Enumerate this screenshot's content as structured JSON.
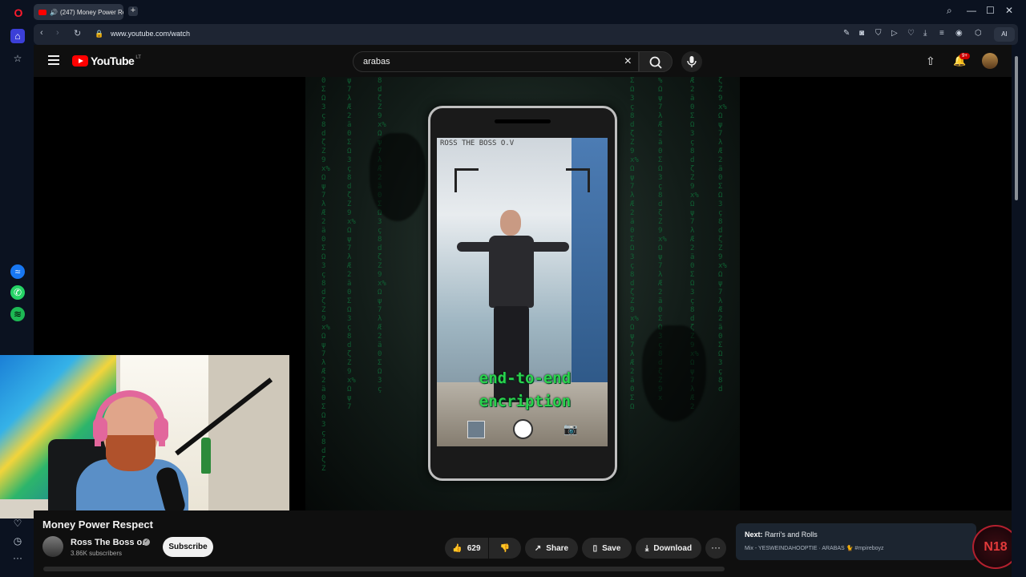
{
  "browser": {
    "tab_title": "(247) Money Power Re",
    "new_tab": "+",
    "url": "www.youtube.com/watch",
    "ai_label": "AI"
  },
  "youtube": {
    "logo_text": "YouTube",
    "country_code": "LT",
    "search_query": "arabas",
    "notification_badge": "9+"
  },
  "video_art": {
    "phone_watermark": "ROSS THE BOSS O.V",
    "caption_line1": "end-to-end",
    "caption_line2": "encription"
  },
  "video": {
    "title": "Money Power Respect",
    "channel_name": "Ross The Boss o.v",
    "subscribers": "3.86K subscribers",
    "subscribe_label": "Subscribe",
    "likes": "629",
    "share_label": "Share",
    "save_label": "Save",
    "download_label": "Download",
    "more_label": "···"
  },
  "next": {
    "prefix": "Next:",
    "title": "Rarri's and Rolls",
    "subtitle": "Mix - YESWEINDAHOOPTIE · ARABAS 🐈 #mpireboyz"
  },
  "overlay_badge": "N18",
  "colors": {
    "youtube_red": "#ff0000",
    "matrix_green": "#2ad24d",
    "page_bg": "#0f0f0f"
  }
}
